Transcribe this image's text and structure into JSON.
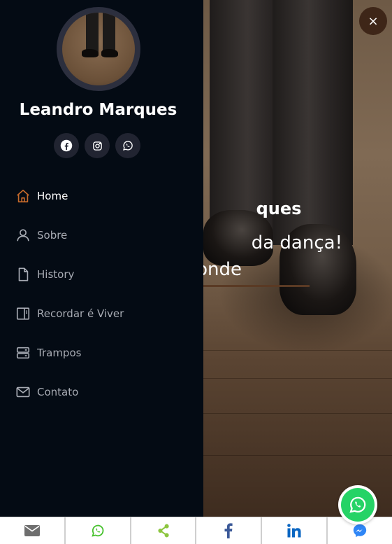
{
  "profile": {
    "name": "Leandro Marques"
  },
  "socials": [
    {
      "icon": "facebook-icon"
    },
    {
      "icon": "instagram-icon"
    },
    {
      "icon": "whatsapp-icon"
    }
  ],
  "nav": {
    "items": [
      {
        "label": "Home",
        "icon": "home-icon",
        "active": true
      },
      {
        "label": "Sobre",
        "icon": "user-icon"
      },
      {
        "label": "History",
        "icon": "file-icon"
      },
      {
        "label": "Recordar é Viver",
        "icon": "book-icon"
      },
      {
        "label": "Trampos",
        "icon": "server-icon"
      },
      {
        "label": "Contato",
        "icon": "envelope-icon"
      }
    ]
  },
  "hero": {
    "name_fragment": "ques",
    "line1_fragment": "da dança!",
    "line2_fragment": "paço onde"
  },
  "close": {
    "label": "×"
  },
  "share_bar": [
    "email",
    "whatsapp",
    "share",
    "facebook",
    "linkedin",
    "messenger"
  ],
  "colors": {
    "sidebar_bg": "#040b14",
    "accent": "#c66a2b",
    "social_bg": "#212431",
    "whatsapp": "#25d366"
  }
}
